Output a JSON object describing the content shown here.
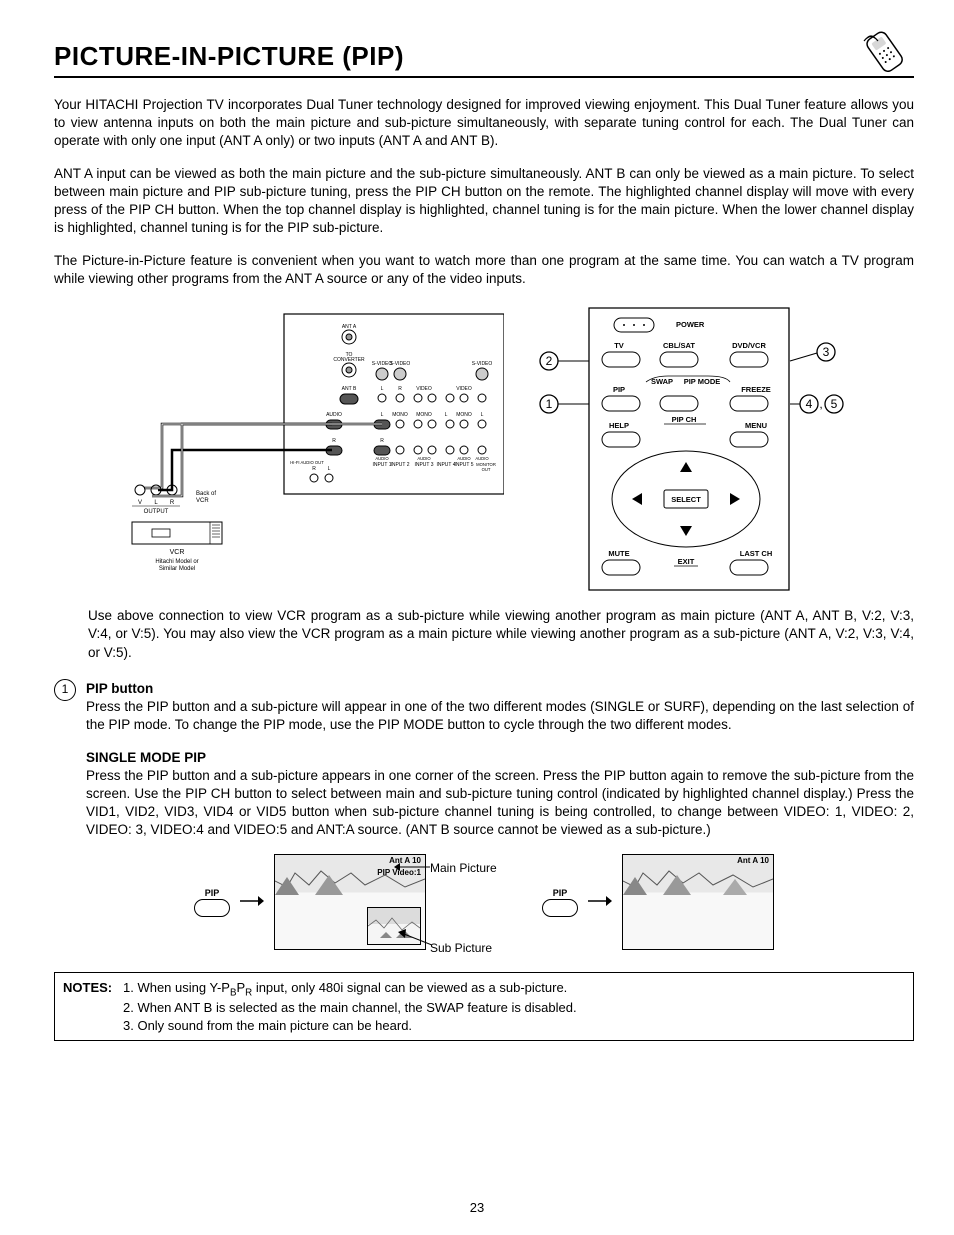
{
  "header": {
    "title": "PICTURE-IN-PICTURE (PIP)"
  },
  "intro": {
    "p1": "Your HITACHI Projection TV incorporates Dual Tuner technology designed for improved viewing enjoyment. This Dual Tuner feature allows you to view antenna inputs on both the main picture and sub-picture simultaneously, with separate tuning control for each.  The Dual Tuner can operate with only one input (ANT A only) or two inputs (ANT A and ANT B).",
    "p2": "ANT A input can be viewed as both the main picture and the sub-picture simultaneously.  ANT B can only be viewed as a main picture.  To select between main picture and PIP sub-picture tuning, press the PIP CH button on the remote.  The highlighted channel display will move with every press of the PIP CH button.  When the top channel display is highlighted, channel tuning is for the main picture.  When the lower channel display is highlighted, channel tuning is for the PIP sub-picture.",
    "p3": "The Picture-in-Picture feature is convenient when you want to watch more than one program at the same time.  You can watch a TV program while viewing other programs from the ANT A source or any of the video inputs."
  },
  "connection_diagram": {
    "labels": {
      "ant_a": "ANT A",
      "to_conv": "TO CONVERTER",
      "ant_b": "ANT B",
      "svideo": "S-VIDEO",
      "video": "VIDEO",
      "audio": "AUDIO",
      "mono": "MONO",
      "inputs": [
        "AUDIO",
        "INPUT 1",
        "INPUT 2",
        "INPUT 3",
        "INPUT 4",
        "INPUT 5",
        "MONITOR OUT"
      ],
      "r": "R",
      "l": "L",
      "back_of_vcr": "Back of VCR",
      "output": "OUTPUT",
      "v": "V",
      "vcr": "VCR",
      "vcr_caption": "Hitachi Model or Similar Model"
    }
  },
  "remote_diagram": {
    "labels": {
      "power": "POWER",
      "tv": "TV",
      "cbl": "CBL/SAT",
      "dvd": "DVD/VCR",
      "pip": "PIP",
      "swap": "SWAP",
      "pip_mode": "PIP MODE",
      "freeze": "FREEZE",
      "help": "HELP",
      "pip_ch": "PIP CH",
      "menu": "MENU",
      "select": "SELECT",
      "mute": "MUTE",
      "exit": "EXIT",
      "last_ch": "LAST CH"
    },
    "callouts": {
      "c1": "1",
      "c2": "2",
      "c3": "3",
      "c45": "4 , 5"
    }
  },
  "caption": "Use above connection to view VCR program as a sub-picture while viewing another program as main picture (ANT A, ANT B, V:2, V:3, V:4, or V:5).  You may also view the VCR program as a main picture while viewing another program as a sub-picture (ANT A, V:2, V:3, V:4, or V:5).",
  "item1": {
    "num": "1",
    "title": "PIP button",
    "text": "Press the PIP button and a sub-picture will appear in one of the two different modes (SINGLE or SURF), depending on the last selection of the PIP mode.  To change the PIP mode, use the PIP MODE button to cycle through the two different modes."
  },
  "single_mode": {
    "title": "SINGLE MODE PIP",
    "text": "Press the PIP button and a sub-picture appears in one corner of the screen.  Press the PIP button again to remove the sub-picture from the screen.  Use the PIP CH button to select between main and sub-picture tuning control (indicated by highlighted channel display.)  Press the VID1, VID2, VID3, VID4 or VID5  button when sub-picture channel tuning is being controlled, to change between VIDEO: 1, VIDEO: 2, VIDEO: 3, VIDEO:4 and VIDEO:5 and ANT:A source.  (ANT B source cannot be viewed as a sub-picture.)"
  },
  "screens": {
    "pip_label": "PIP",
    "s1": {
      "top": "Ant A   10",
      "sub": "PIP Video:1",
      "callout_main": "Main Picture",
      "callout_sub": "Sub Picture"
    },
    "s2": {
      "top": "Ant A   10"
    }
  },
  "notes": {
    "lead": "NOTES:",
    "n1_pre": "1.  When using Y-P",
    "n1_b": "B",
    "n1_mid": "P",
    "n1_r": "R",
    "n1_post": " input, only 480i signal can be viewed as a sub-picture.",
    "n2": "2.  When ANT B is selected as the main channel, the SWAP feature is disabled.",
    "n3": "3.  Only sound from the main picture can be heard."
  },
  "page_number": "23"
}
